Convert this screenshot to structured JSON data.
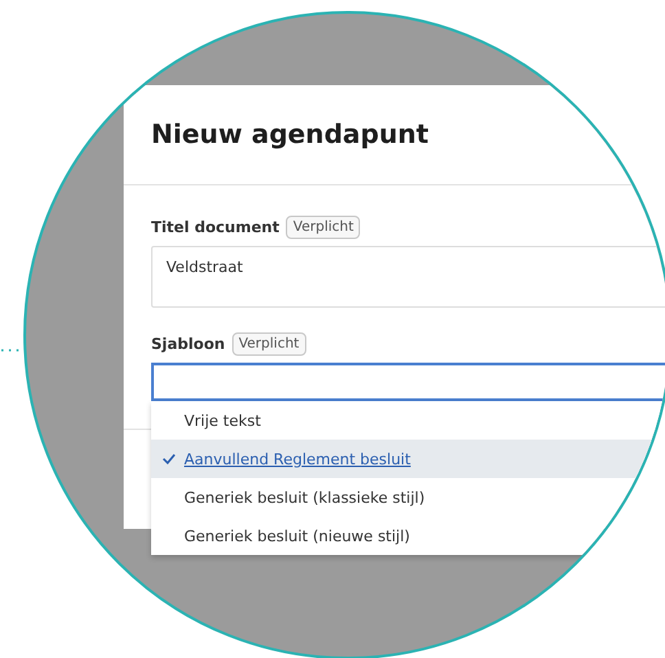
{
  "dialog": {
    "title": "Nieuw agendapunt",
    "fields": [
      {
        "label": "Titel document",
        "badge": "Verplicht",
        "kind": "textarea",
        "value": "Veldstraat"
      },
      {
        "label": "Sjabloon",
        "badge": "Verplicht",
        "kind": "select",
        "focused": true,
        "options": [
          {
            "label": "Vrije tekst",
            "selected": false
          },
          {
            "label": "Aanvullend Reglement besluit",
            "selected": true
          },
          {
            "label": "Generiek besluit (klassieke stijl)",
            "selected": false
          },
          {
            "label": "Generiek besluit (nieuwe stijl)",
            "selected": false
          }
        ]
      }
    ]
  }
}
